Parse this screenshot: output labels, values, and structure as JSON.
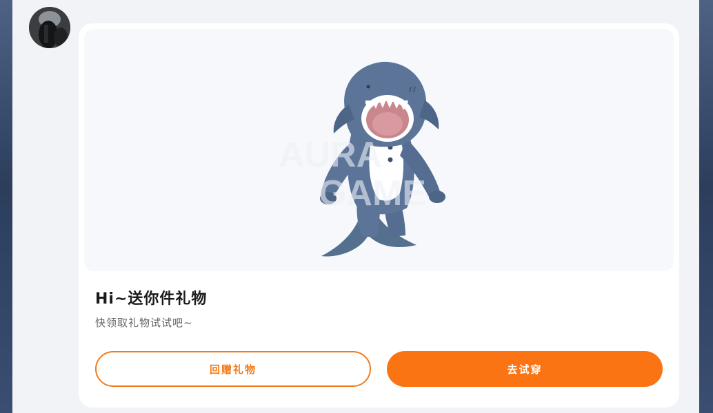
{
  "user": {
    "avatar_icon": "user-avatar"
  },
  "gift": {
    "image_icon": "shark-costume-illustration",
    "title": "Hi~送你件礼物",
    "subtitle": "快领取礼物试试吧~"
  },
  "actions": {
    "return_gift_label": "回赠礼物",
    "try_on_label": "去试穿"
  },
  "colors": {
    "accent": "#fb7414",
    "accent_border": "#f47a18",
    "card_bg": "#ffffff",
    "image_bg": "#f6f8fb",
    "page_bg": "#f1f3f6",
    "shark_body": "#5b7498"
  }
}
